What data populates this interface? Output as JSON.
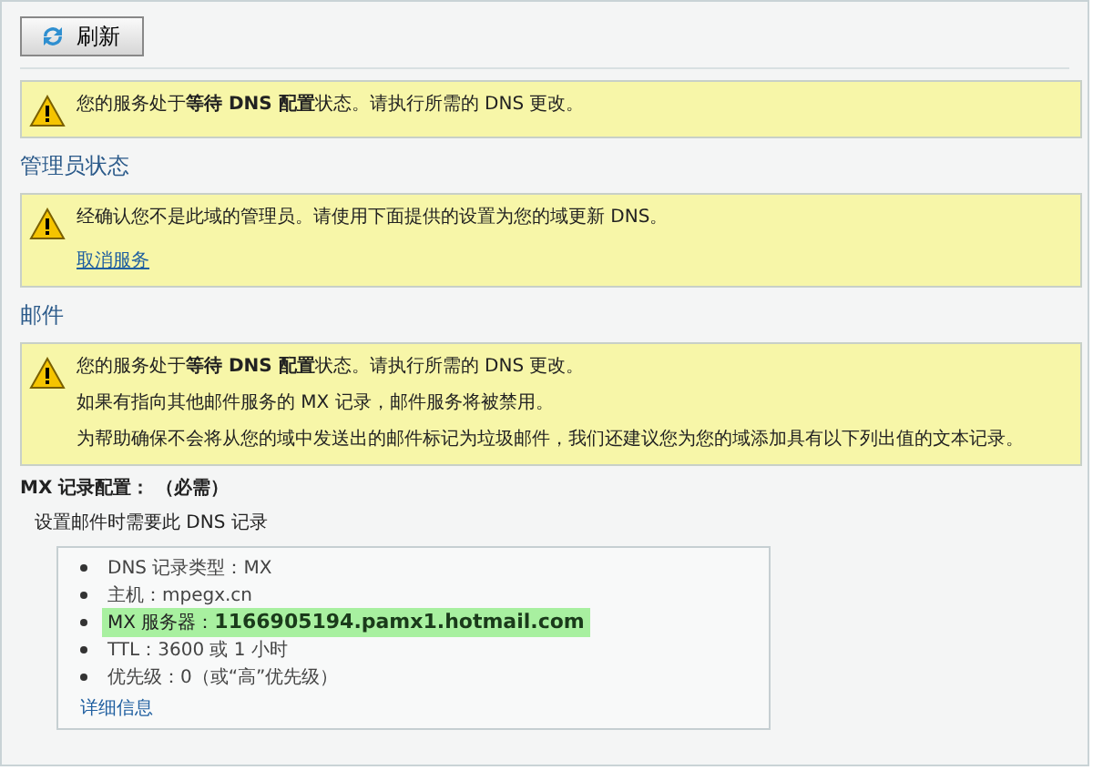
{
  "toolbar": {
    "refresh_button": "刷新"
  },
  "status_notice": {
    "paragraphs": [
      "您的服务处于**等待  DNS 配置**状态。请执行所需的 DNS 更改。"
    ]
  },
  "sections": [
    {
      "heading": "管理员状态",
      "notice": {
        "paragraphs": [
          "经确认您不是此域的管理员。请使用下面提供的设置为您的域更新 DNS。"
        ],
        "link": "取消服务"
      }
    },
    {
      "heading": "邮件",
      "notice": {
        "paragraphs": [
          "您的服务处于**等待  DNS 配置**状态。请执行所需的 DNS 更改。",
          "如果有指向其他邮件服务的 MX 记录，邮件服务将被禁用。",
          "为帮助确保不会将从您的域中发送出的邮件标记为垃圾邮件，我们还建议您为您的域添加具有以下列出值的文本记录。"
        ]
      }
    }
  ],
  "mx_config": {
    "title": "MX 记录配置： （必需）",
    "subtitle": "设置邮件时需要此 DNS 记录",
    "records": [
      {
        "text": "DNS 记录类型：MX",
        "highlighted": false
      },
      {
        "text": "主机：mpegx.cn",
        "highlighted": false
      },
      {
        "text": "MX 服务器：**1166905194.pamx1.hotmail.com**",
        "highlighted": true
      },
      {
        "text": "TTL：3600 或 1 小时",
        "highlighted": false
      },
      {
        "text": "优先级：0（或“高”优先级）",
        "highlighted": false
      }
    ],
    "details_link": "详细信息"
  }
}
